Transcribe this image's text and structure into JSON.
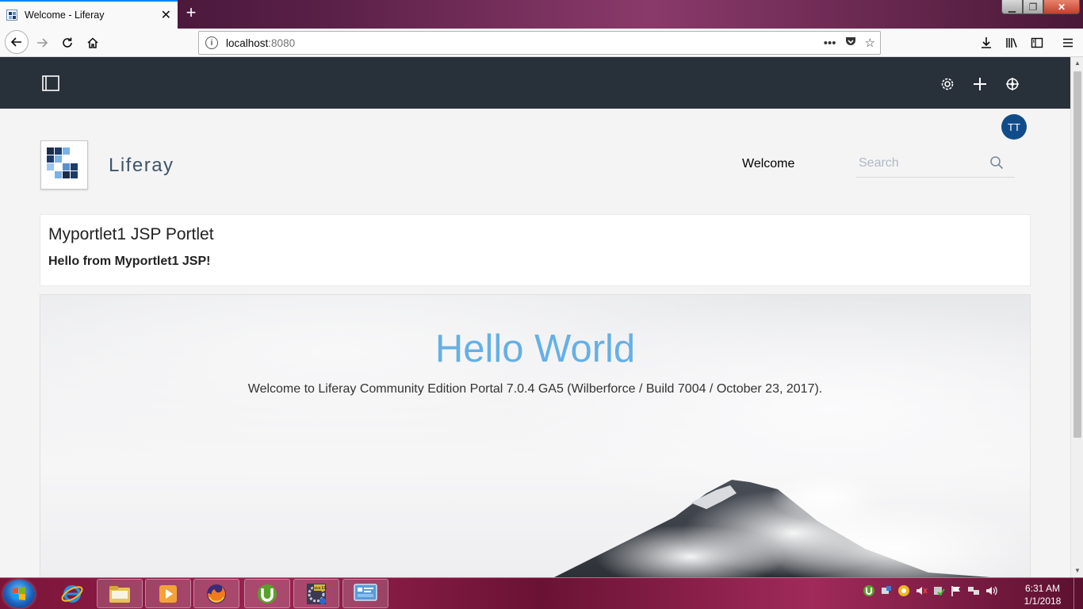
{
  "browser": {
    "tab_title": "Welcome - Liferay",
    "tab_close": "✕",
    "new_tab": "+",
    "url_host": "localhost",
    "url_port": ":8080",
    "url_actions": [
      "•••",
      "pocket",
      "☆"
    ]
  },
  "controlmenu": {
    "icons": [
      "product-menu-icon",
      "gear-icon",
      "add-icon",
      "simulation-icon"
    ]
  },
  "header": {
    "avatar_initials": "TT",
    "site_name": "Liferay",
    "nav_item": "Welcome",
    "search_placeholder": "Search"
  },
  "portlet": {
    "title": "Myportlet1 JSP Portlet",
    "message": "Hello from Myportlet1 JSP!"
  },
  "hero": {
    "heading": "Hello World",
    "subheading": "Welcome to Liferay Community Edition Portal 7.0.4 GA5 (Wilberforce / Build 7004 / October 23, 2017)."
  },
  "taskbar": {
    "clock_time": "6:31 AM",
    "clock_date": "1/1/2018",
    "apps": [
      "internet-explorer",
      "file-explorer",
      "media-player",
      "firefox",
      "utorrent",
      "java-ee-eclipse",
      "control-panel"
    ]
  },
  "colors": {
    "control_menu_bg": "#28303a",
    "hero_heading": "#65b0e6",
    "avatar_bg": "#114c8a",
    "taskbar_bg": "#8a1c48"
  }
}
